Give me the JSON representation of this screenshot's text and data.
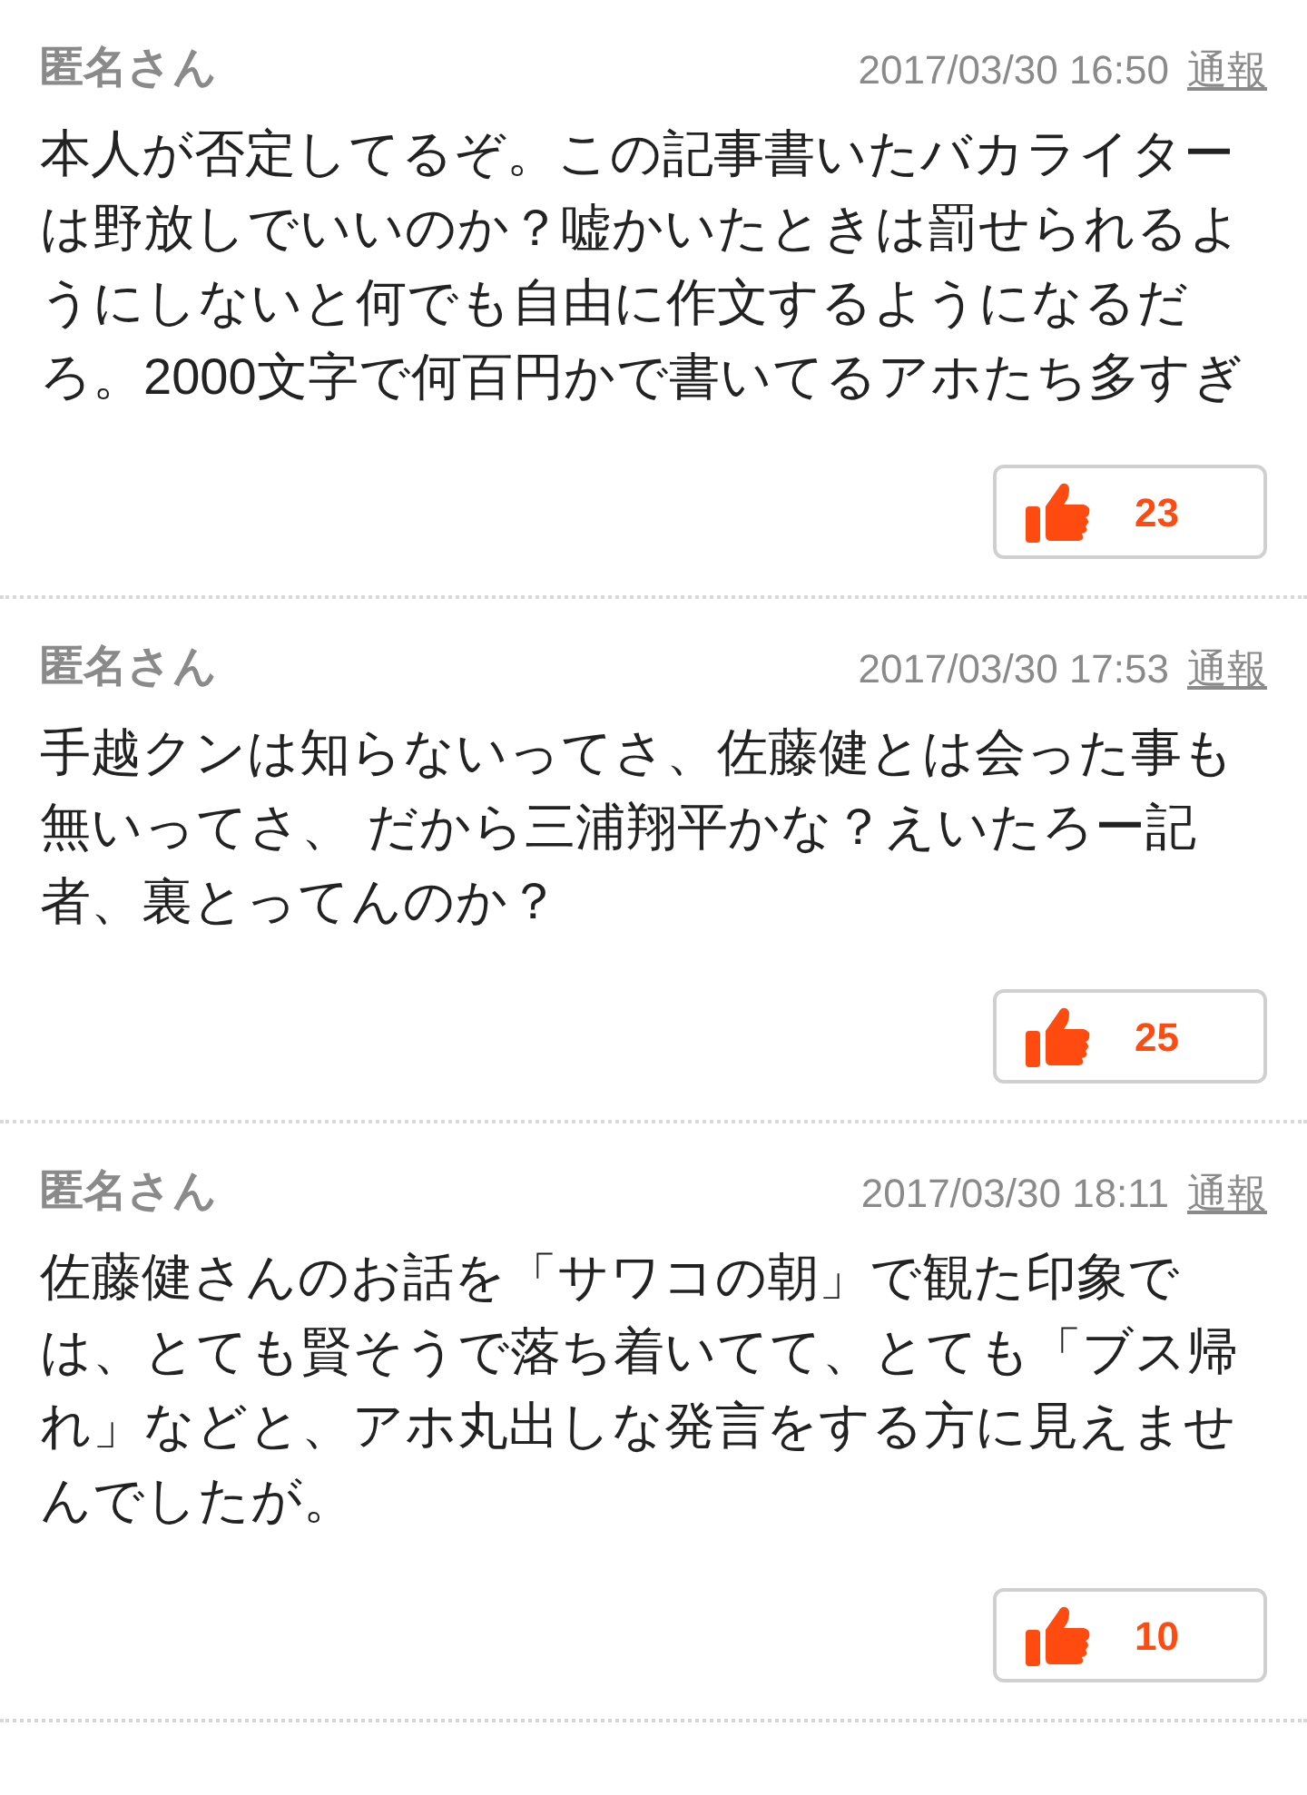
{
  "comments": [
    {
      "author": "匿名さん",
      "time": "2017/03/30 16:50",
      "report": "通報",
      "body": "本人が否定してるぞ。この記事書いたバカライターは野放しでいいのか？嘘かいたときは罰せられるようにしないと何でも自由に作文するようになるだろ。2000文字で何百円かで書いてるアホたち多すぎ",
      "likes": "23"
    },
    {
      "author": "匿名さん",
      "time": "2017/03/30 17:53",
      "report": "通報",
      "body": "手越クンは知らないってさ、佐藤健とは会った事も無いってさ、 だから三浦翔平かな？えいたろー記者、裏とってんのか？",
      "likes": "25"
    },
    {
      "author": "匿名さん",
      "time": "2017/03/30 18:11",
      "report": "通報",
      "body": "佐藤健さんのお話を「サワコの朝」で観た印象では、とても賢そうで落ち着いてて、とても「ブス帰れ」などと、アホ丸出しな発言をする方に見えませんでしたが。",
      "likes": "10"
    }
  ]
}
